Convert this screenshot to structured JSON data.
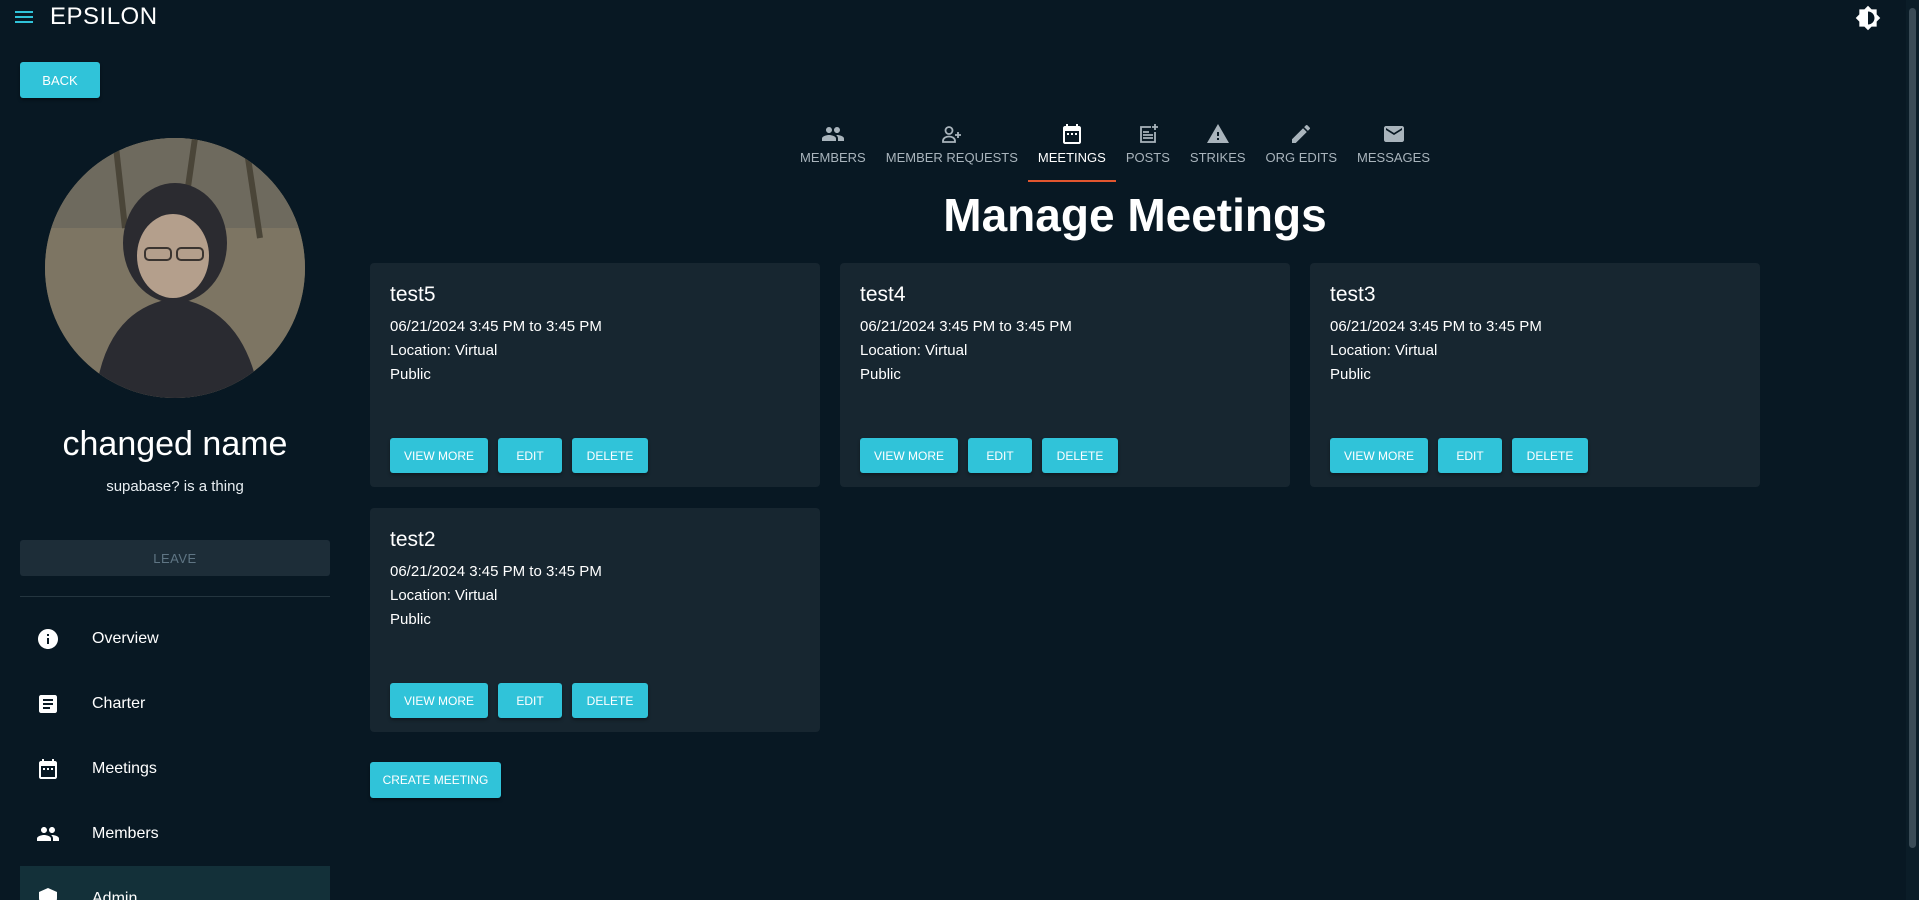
{
  "header": {
    "title": "EPSILON"
  },
  "back_label": "BACK",
  "org": {
    "name": "changed name",
    "description": "supabase? is a thing",
    "leave_label": "LEAVE"
  },
  "sidebar": {
    "items": [
      {
        "label": "Overview",
        "icon": "info-icon"
      },
      {
        "label": "Charter",
        "icon": "document-icon"
      },
      {
        "label": "Meetings",
        "icon": "calendar-icon"
      },
      {
        "label": "Members",
        "icon": "people-icon"
      },
      {
        "label": "Admin",
        "icon": "shield-icon"
      }
    ]
  },
  "tabs": [
    {
      "label": "MEMBERS",
      "icon": "people-icon"
    },
    {
      "label": "MEMBER REQUESTS",
      "icon": "person-add-icon"
    },
    {
      "label": "MEETINGS",
      "icon": "calendar-icon"
    },
    {
      "label": "POSTS",
      "icon": "post-add-icon"
    },
    {
      "label": "STRIKES",
      "icon": "warning-icon"
    },
    {
      "label": "ORG EDITS",
      "icon": "pencil-icon"
    },
    {
      "label": "MESSAGES",
      "icon": "mail-icon"
    }
  ],
  "active_tab": "MEETINGS",
  "page_title": "Manage Meetings",
  "meetings": [
    {
      "title": "test5",
      "time": "06/21/2024 3:45 PM to 3:45 PM",
      "location": "Location: Virtual",
      "visibility": "Public"
    },
    {
      "title": "test4",
      "time": "06/21/2024 3:45 PM to 3:45 PM",
      "location": "Location: Virtual",
      "visibility": "Public"
    },
    {
      "title": "test3",
      "time": "06/21/2024 3:45 PM to 3:45 PM",
      "location": "Location: Virtual",
      "visibility": "Public"
    },
    {
      "title": "test2",
      "time": "06/21/2024 3:45 PM to 3:45 PM",
      "location": "Location: Virtual",
      "visibility": "Public"
    }
  ],
  "card_actions": {
    "view_more": "VIEW MORE",
    "edit": "EDIT",
    "delete": "DELETE"
  },
  "create_label": "CREATE MEETING",
  "colors": {
    "accent": "#30c3d9",
    "background": "#081823",
    "card": "#172630",
    "tab_indicator": "#e2562f"
  }
}
